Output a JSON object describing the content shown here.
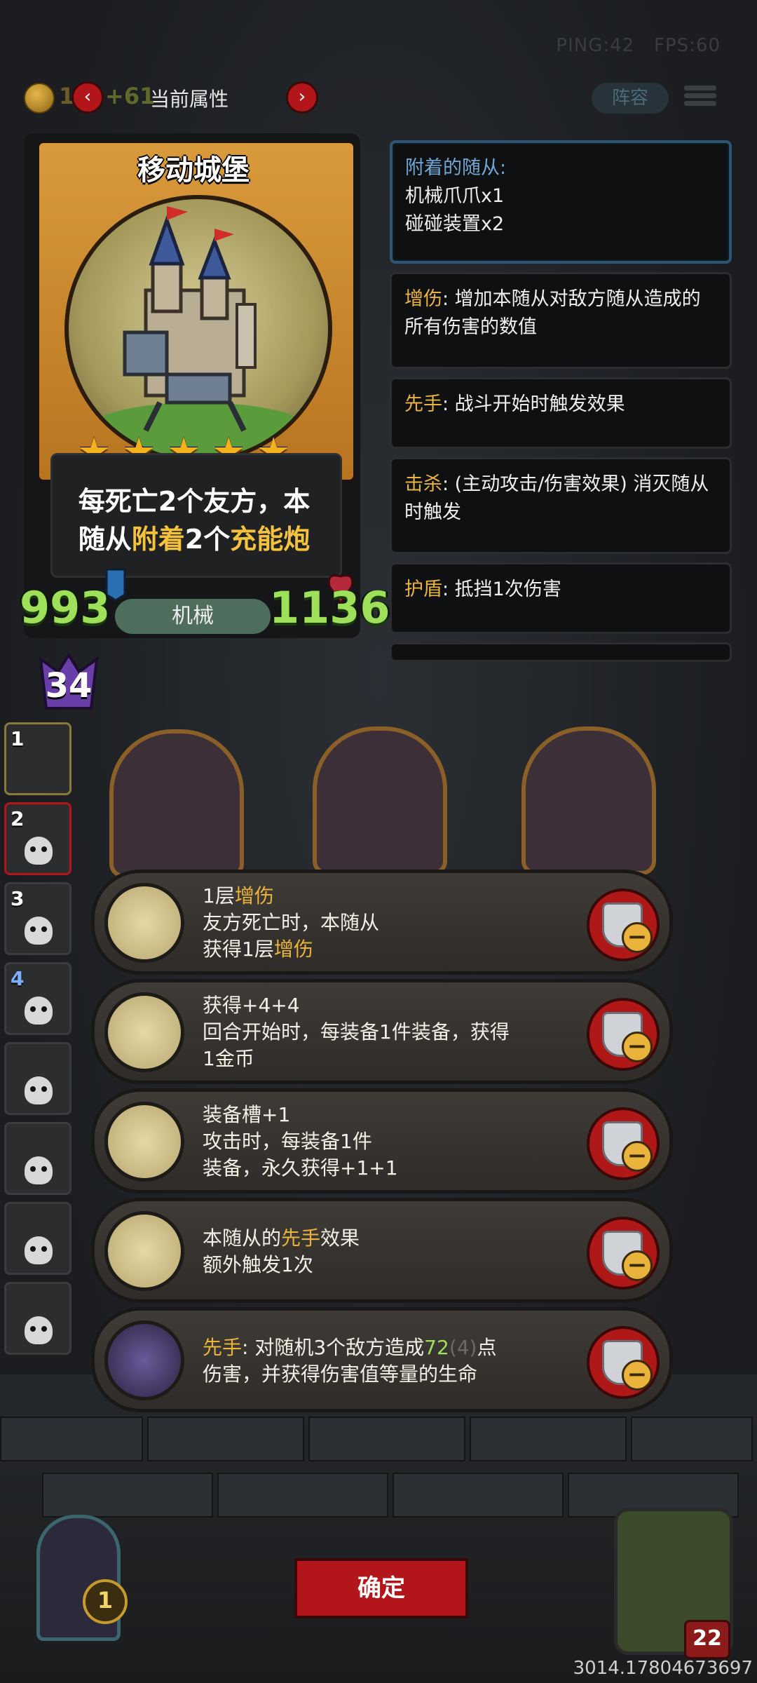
{
  "hud": {
    "ping": "PING:42",
    "fps": "FPS:60",
    "gold": "1",
    "gold_bonus": "+61",
    "title": "当前属性",
    "prev": "‹",
    "next": "›",
    "lineup": "阵容"
  },
  "card": {
    "name": "移动城堡",
    "stars": 5,
    "desc_line1": "每死亡2个友方，本",
    "desc_line2_a": "随从",
    "desc_line2_b": "附着",
    "desc_line2_c": "2个",
    "desc_line2_d": "充能炮",
    "attack": "993",
    "health": "1136",
    "tribe": "机械",
    "level": "34"
  },
  "keywords": {
    "attached_title": "附着的随从:",
    "attached_1": "机械爪爪x1",
    "attached_2": "碰碰装置x2",
    "kw1_name": "增伤",
    "kw1_text": ": 增加本随从对敌方随从造成的所有伤害的数值",
    "kw2_name": "先手",
    "kw2_text": ": 战斗开始时触发效果",
    "kw3_name": "击杀",
    "kw3_text": ": (主动攻击/伤害效果) 消灭随从时触发",
    "kw4_name": "护盾",
    "kw4_text": ": 抵挡1次伤害"
  },
  "sidebar": [
    {
      "num": "1"
    },
    {
      "num": "2"
    },
    {
      "num": "3"
    },
    {
      "num": "4"
    },
    {
      "num": ""
    },
    {
      "num": ""
    },
    {
      "num": ""
    },
    {
      "num": ""
    }
  ],
  "equipment": [
    {
      "l1a": "1层",
      "l1b": "增伤",
      "l2": "友方死亡时，本随从",
      "l3a": "获得1层",
      "l3b": "增伤"
    },
    {
      "l1": "获得+4+4",
      "l2": "回合开始时，每装备1件装备，获得",
      "l3": "1金币"
    },
    {
      "l1": "装备槽+1",
      "l2": "攻击时，每装备1件",
      "l3": "装备，永久获得+1+1"
    },
    {
      "l1a": "本随从的",
      "l1b": "先手",
      "l1c": "效果",
      "l2": "额外触发1次"
    },
    {
      "l1a": "先手",
      "l1b": ": 对随机3个敌方造成",
      "l1c": "72",
      "l1d": "(4)",
      "l1e": "点",
      "l2": "伤害，并获得伤害值等量的生命"
    }
  ],
  "bottom": {
    "confirm": "确定",
    "deck_count": "1",
    "hero_hp": "22",
    "coords": "3014.17804673697"
  },
  "colors": {
    "keyword": "#e9b33c",
    "stat_green": "#9fe05a",
    "button_red": "#b3161a",
    "attached_blue": "#6fa8d8"
  }
}
